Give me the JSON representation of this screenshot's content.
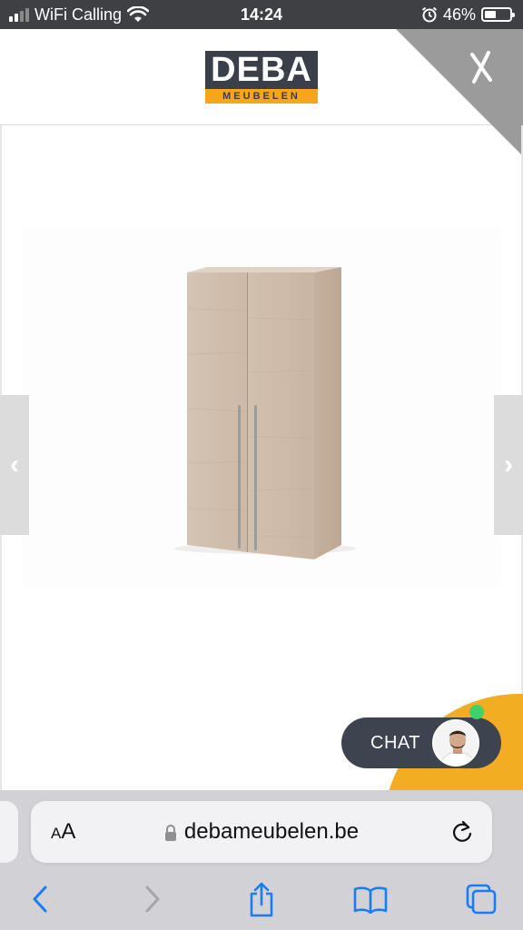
{
  "status_bar": {
    "carrier": "WiFi Calling",
    "time": "14:24",
    "battery_percent": "46%",
    "battery_level": 0.46,
    "icons": [
      "signal-icon",
      "wifi-icon",
      "alarm-icon",
      "battery-icon"
    ]
  },
  "header": {
    "logo_main": "DEBA",
    "logo_sub": "MEUBELEN",
    "close_icon": "close-icon"
  },
  "product": {
    "image": "wardrobe-product-image",
    "prev_icon": "‹",
    "next_icon": "›"
  },
  "chat": {
    "label": "CHAT",
    "status_color": "#3fd16b",
    "accent_color": "#f3ad22"
  },
  "browser": {
    "aa_label_small": "A",
    "aa_label_large": "A",
    "url": "debameubelen.be",
    "toolbar": [
      "back-icon",
      "forward-icon",
      "share-icon",
      "bookmarks-icon",
      "tabs-icon"
    ]
  },
  "colors": {
    "brand_dark": "#3b3f4a",
    "brand_yellow": "#f5a61b",
    "ios_blue": "#1a7cf5"
  }
}
